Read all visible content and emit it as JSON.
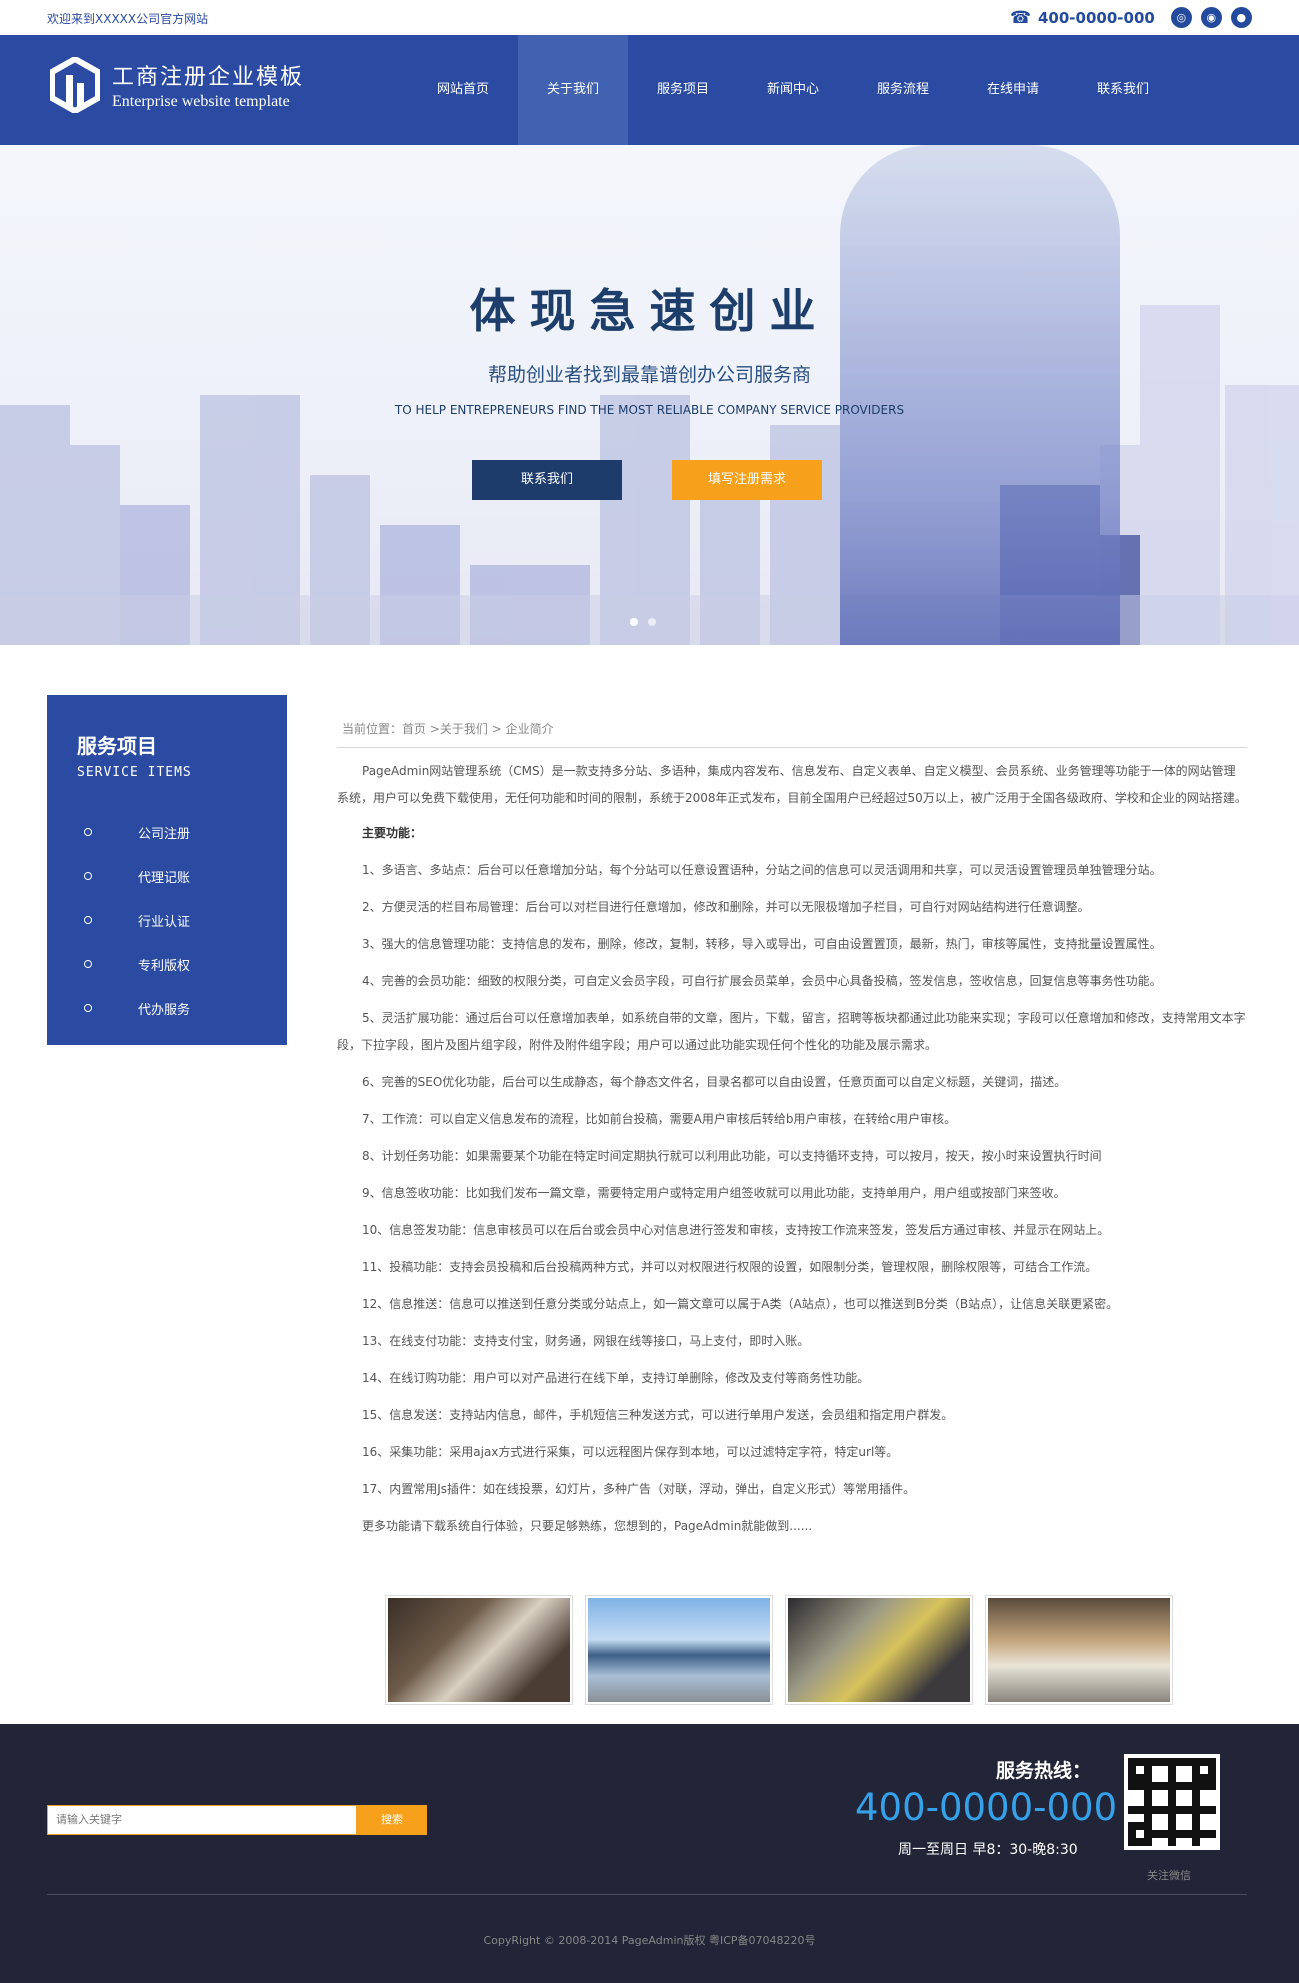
{
  "topbar": {
    "welcome": "欢迎来到XXXXX公司官方网站",
    "hotline": "400-0000-000",
    "social_icons": [
      "wechat-icon",
      "weibo-icon",
      "qq-icon"
    ]
  },
  "header": {
    "logo_cn": "工商注册企业模板",
    "logo_en": "Enterprise website template",
    "nav": [
      {
        "label": "网站首页",
        "active": false
      },
      {
        "label": "关于我们",
        "active": true
      },
      {
        "label": "服务项目",
        "active": false
      },
      {
        "label": "新闻中心",
        "active": false
      },
      {
        "label": "服务流程",
        "active": false
      },
      {
        "label": "在线申请",
        "active": false
      },
      {
        "label": "联系我们",
        "active": false
      }
    ]
  },
  "banner": {
    "title": "体现急速创业",
    "subtitle": "帮助创业者找到最靠谱创办公司服务商",
    "english": "TO HELP ENTREPRENEURS FIND THE MOST RELIABLE COMPANY SERVICE PROVIDERS",
    "btn_contact": "联系我们",
    "btn_register": "填写注册需求"
  },
  "sidebar": {
    "title": "服务项目",
    "subtitle": "SERVICE ITEMS",
    "items": [
      "公司注册",
      "代理记账",
      "行业认证",
      "专利版权",
      "代办服务"
    ]
  },
  "breadcrumb": {
    "prefix": "当前位置：",
    "home": "首页",
    "sep1": " >",
    "about": "关于我们",
    "sep2": " > ",
    "current": "企业简介"
  },
  "content": {
    "intro": "PageAdmin网站管理系统（CMS）是一款支持多分站、多语种，集成内容发布、信息发布、自定义表单、自定义模型、会员系统、业务管理等功能于一体的网站管理系统，用户可以免费下载使用，无任何功能和时间的限制，系统于2008年正式发布，目前全国用户已经超过50万以上，被广泛用于全国各级政府、学校和企业的网站搭建。",
    "heading": "主要功能：",
    "items": [
      "1、多语言、多站点：后台可以任意增加分站，每个分站可以任意设置语种，分站之间的信息可以灵活调用和共享，可以灵活设置管理员单独管理分站。",
      "2、方便灵活的栏目布局管理：后台可以对栏目进行任意增加，修改和删除，并可以无限极增加子栏目，可自行对网站结构进行任意调整。",
      "3、强大的信息管理功能：支持信息的发布，删除，修改，复制，转移，导入或导出，可自由设置置顶，最新，热门，审核等属性，支持批量设置属性。",
      "4、完善的会员功能：细致的权限分类，可自定义会员字段，可自行扩展会员菜单，会员中心具备投稿，签发信息，签收信息，回复信息等事务性功能。",
      "5、灵活扩展功能：通过后台可以任意增加表单，如系统自带的文章，图片，下载，留言，招聘等板块都通过此功能来实现；字段可以任意增加和修改，支持常用文本字段，下拉字段，图片及图片组字段，附件及附件组字段；用户可以通过此功能实现任何个性化的功能及展示需求。",
      "6、完善的SEO优化功能，后台可以生成静态，每个静态文件名，目录名都可以自由设置，任意页面可以自定义标题，关键词，描述。",
      "7、工作流：可以自定义信息发布的流程，比如前台投稿，需要A用户审核后转给b用户审核，在转给c用户审核。",
      "8、计划任务功能：如果需要某个功能在特定时间定期执行就可以利用此功能，可以支持循环支持，可以按月，按天，按小时来设置执行时间",
      "9、信息签收功能：比如我们发布一篇文章，需要特定用户或特定用户组签收就可以用此功能，支持单用户，用户组或按部门来签收。",
      "10、信息签发功能：信息审核员可以在后台或会员中心对信息进行签发和审核，支持按工作流来签发，签发后方通过审核、并显示在网站上。",
      "11、投稿功能：支持会员投稿和后台投稿两种方式，并可以对权限进行权限的设置，如限制分类，管理权限，删除权限等，可结合工作流。",
      "12、信息推送：信息可以推送到任意分类或分站点上，如一篇文章可以属于A类（A站点），也可以推送到B分类（B站点），让信息关联更紧密。",
      "13、在线支付功能：支持支付宝，财务通，网银在线等接口，马上支付，即时入账。",
      "14、在线订购功能：用户可以对产品进行在线下单，支持订单删除，修改及支付等商务性功能。",
      "15、信息发送：支持站内信息，邮件，手机短信三种发送方式，可以进行单用户发送，会员组和指定用户群发。",
      "16、采集功能：采用ajax方式进行采集，可以远程图片保存到本地，可以过滤特定字符，特定url等。",
      "17、内置常用Js插件：如在线投票，幻灯片，多种广告（对联，浮动，弹出，自定义形式）等常用插件。"
    ],
    "more": "更多功能请下载系统自行体验，只要足够熟练，您想到的，PageAdmin就能做到......"
  },
  "footer": {
    "search_placeholder": "请输入关键字",
    "search_button": "搜索",
    "service_label": "服务热线：",
    "service_number": "400-0000-000",
    "service_hours": "周一至周日 早8：30-晚8:30",
    "qr_label": "关注微信",
    "copyright": "CopyRight © 2008-2014 PageAdmin版权 粤ICP备07048220号"
  },
  "colors": {
    "brand_blue": "#2b4ba2",
    "accent_orange": "#f7a01b",
    "dark_navy": "#1d3c6b",
    "footer_bg": "#222437",
    "hotline_blue": "#35a1e9"
  }
}
